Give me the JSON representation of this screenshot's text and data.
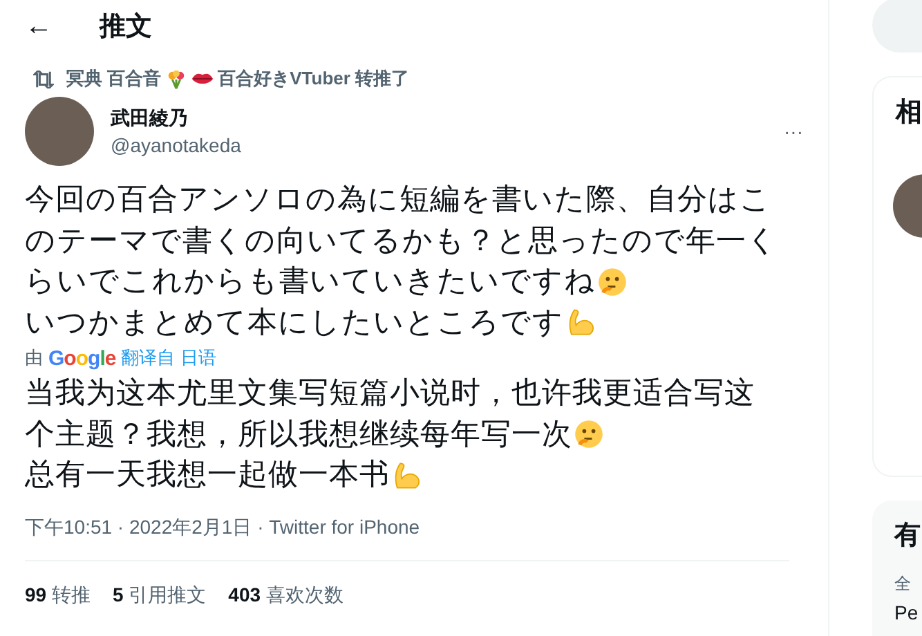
{
  "header": {
    "back": "←",
    "title": "推文"
  },
  "retweeted_by": [
    {
      "kind": "text",
      "text": "冥典 百合音"
    },
    {
      "kind": "bouquet"
    },
    {
      "kind": "lips"
    },
    {
      "kind": "text",
      "text": "百合好きVTuber 转推了"
    }
  ],
  "author": {
    "name": "武田綾乃",
    "handle": "@ayanotakeda",
    "more": "···"
  },
  "original": [
    {
      "kind": "plain",
      "text": "今回の百合アンソロの為に短編を書いた際、自分はこ"
    },
    {
      "kind": "plain",
      "text": "のテーマで書くの向いてるかも？と思ったので年一く"
    },
    {
      "kind": "think",
      "text": "らいでこれからも書いていきたいですね"
    },
    {
      "kind": "flex",
      "text": "いつかまとめて本にしたいところです"
    }
  ],
  "translation": {
    "by": "由",
    "provider": "Google",
    "link": "翻译自 日语"
  },
  "translated": [
    {
      "kind": "plain",
      "text": "当我为这本尤里文集写短篇小说时，也许我更适合写这"
    },
    {
      "kind": "think",
      "text": "个主题？我想，所以我想继续每年写一次"
    },
    {
      "kind": "flex",
      "text": "总有一天我想一起做一本书"
    }
  ],
  "meta": "下午10:51 · 2022年2月1日 · Twitter for iPhone",
  "stats": [
    {
      "count": "99",
      "label": "转推"
    },
    {
      "count": "5",
      "label": "引用推文"
    },
    {
      "count": "403",
      "label": "喜欢次数"
    }
  ],
  "sidebar": {
    "card_title": "相",
    "card2_title": "有",
    "card2_sub": "全",
    "card2_item": "Pe"
  }
}
